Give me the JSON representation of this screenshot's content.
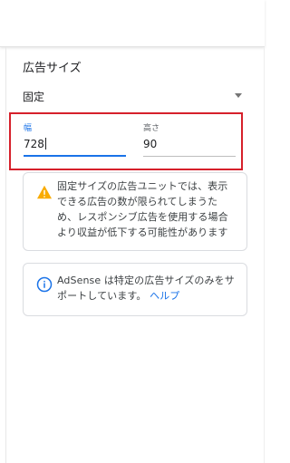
{
  "section_title": "広告サイズ",
  "size_type": {
    "selected": "固定",
    "icon": "chevron-down-icon"
  },
  "width_field": {
    "label": "幅",
    "value": "728"
  },
  "height_field": {
    "label": "高さ",
    "value": "90"
  },
  "warning": {
    "icon": "warning-icon",
    "lines": [
      "固定サイズの広告ユニットでは、表示",
      "できる広告の数が限られてしまうた",
      "め、レスポンシブ広告を使用する場合",
      "より収益が低下する可能性があります"
    ]
  },
  "info": {
    "icon": "info-icon",
    "line1": "AdSense は特定の広告サイズのみをサ",
    "line2_text": "ポートしています。",
    "help_link": "ヘルプ"
  },
  "colors": {
    "accent": "#1a73e8",
    "highlight_border": "#d6202b",
    "warning_icon": "#f9ab00"
  }
}
